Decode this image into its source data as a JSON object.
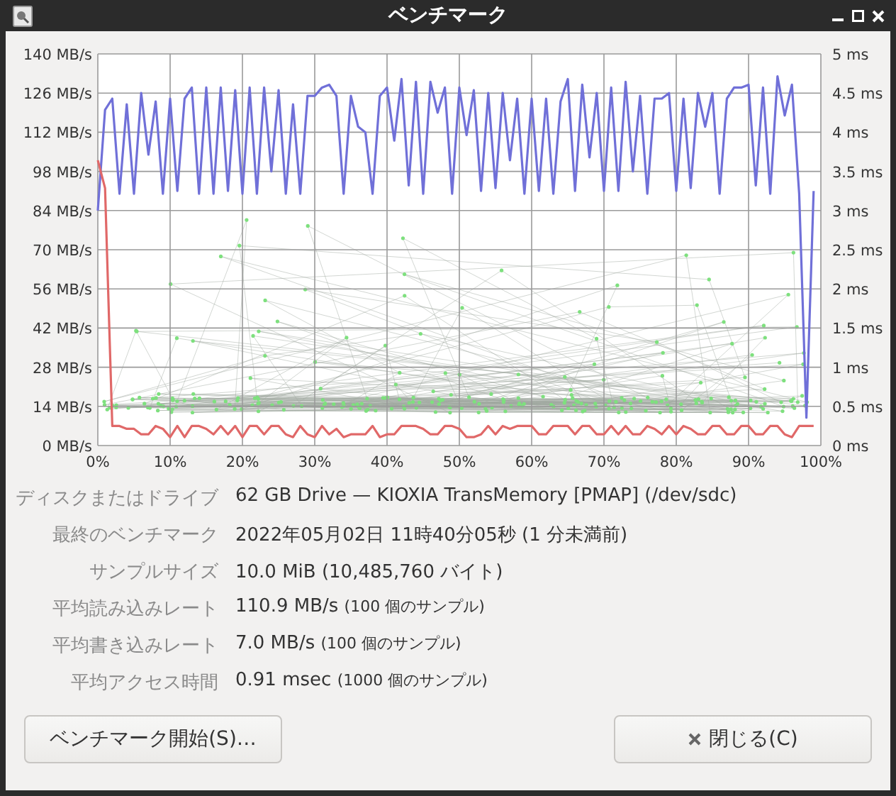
{
  "window": {
    "title": "ベンチマーク"
  },
  "chart": {
    "chart_data": {
      "type": "line",
      "grid": true,
      "xlim": [
        0,
        100
      ],
      "ylim": [
        0,
        140
      ],
      "y2lim": [
        0,
        5
      ],
      "x": [
        0,
        1,
        2,
        3,
        4,
        5,
        6,
        7,
        8,
        9,
        10,
        11,
        12,
        13,
        14,
        15,
        16,
        17,
        18,
        19,
        20,
        21,
        22,
        23,
        24,
        25,
        26,
        27,
        28,
        29,
        30,
        31,
        32,
        33,
        34,
        35,
        36,
        37,
        38,
        39,
        40,
        41,
        42,
        43,
        44,
        45,
        46,
        47,
        48,
        49,
        50,
        51,
        52,
        53,
        54,
        55,
        56,
        57,
        58,
        59,
        60,
        61,
        62,
        63,
        64,
        65,
        66,
        67,
        68,
        69,
        70,
        71,
        72,
        73,
        74,
        75,
        76,
        77,
        78,
        79,
        80,
        81,
        82,
        83,
        84,
        85,
        86,
        87,
        88,
        89,
        90,
        91,
        92,
        93,
        94,
        95,
        96,
        97,
        98,
        99
      ],
      "xticks": [
        {
          "value": 0,
          "label": "0%"
        },
        {
          "value": 10,
          "label": "10%"
        },
        {
          "value": 20,
          "label": "20%"
        },
        {
          "value": 30,
          "label": "30%"
        },
        {
          "value": 40,
          "label": "40%"
        },
        {
          "value": 50,
          "label": "50%"
        },
        {
          "value": 60,
          "label": "60%"
        },
        {
          "value": 70,
          "label": "70%"
        },
        {
          "value": 80,
          "label": "80%"
        },
        {
          "value": 90,
          "label": "90%"
        },
        {
          "value": 100,
          "label": "100%"
        }
      ],
      "yticks": [
        {
          "value": 0,
          "label": "0 MB/s"
        },
        {
          "value": 14,
          "label": "14 MB/s"
        },
        {
          "value": 28,
          "label": "28 MB/s"
        },
        {
          "value": 42,
          "label": "42 MB/s"
        },
        {
          "value": 56,
          "label": "56 MB/s"
        },
        {
          "value": 70,
          "label": "70 MB/s"
        },
        {
          "value": 84,
          "label": "84 MB/s"
        },
        {
          "value": 98,
          "label": "98 MB/s"
        },
        {
          "value": 112,
          "label": "112 MB/s"
        },
        {
          "value": 126,
          "label": "126 MB/s"
        },
        {
          "value": 140,
          "label": "140 MB/s"
        }
      ],
      "y2ticks": [
        {
          "value": 0,
          "label": "0 ms"
        },
        {
          "value": 0.5,
          "label": "0.5 ms"
        },
        {
          "value": 1,
          "label": "1 ms"
        },
        {
          "value": 1.5,
          "label": "1.5 ms"
        },
        {
          "value": 2,
          "label": "2 ms"
        },
        {
          "value": 2.5,
          "label": "2.5 ms"
        },
        {
          "value": 3,
          "label": "3 ms"
        },
        {
          "value": 3.5,
          "label": "3.5 ms"
        },
        {
          "value": 4,
          "label": "4 ms"
        },
        {
          "value": 4.5,
          "label": "4.5 ms"
        },
        {
          "value": 5,
          "label": "5 ms"
        }
      ],
      "series": [
        {
          "color": "#7070d8",
          "values": [
            84,
            120,
            124,
            90,
            122,
            90,
            126,
            104,
            123,
            90,
            124,
            91,
            124,
            128,
            90,
            128,
            90,
            128,
            91,
            127,
            90,
            128,
            90,
            128,
            98,
            127,
            90,
            122,
            90,
            125,
            125,
            128,
            129,
            125,
            90,
            125,
            114,
            112,
            90,
            125,
            128,
            109,
            131,
            93,
            130,
            90,
            130,
            119,
            128,
            90,
            128,
            111,
            127,
            91,
            126,
            92,
            126,
            102,
            124,
            90,
            124,
            91,
            124,
            90,
            123,
            131,
            91,
            129,
            103,
            126,
            91,
            128,
            91,
            130,
            98,
            125,
            90,
            124,
            124,
            126,
            91,
            124,
            92,
            126,
            114,
            126,
            90,
            124,
            128,
            128,
            129,
            93,
            128,
            90,
            132,
            118,
            129,
            90,
            10,
            91
          ]
        },
        {
          "color": "#e06868",
          "values": [
            102,
            92,
            7,
            7,
            6,
            6,
            4,
            4,
            7,
            6,
            3,
            7,
            3,
            7,
            7,
            6,
            4,
            7,
            4,
            7,
            3,
            7,
            7,
            4,
            7,
            7,
            4,
            3,
            7,
            4,
            3,
            7,
            4,
            6,
            3,
            4,
            4,
            4,
            7,
            3,
            4,
            4,
            7,
            7,
            7,
            6,
            4,
            4,
            7,
            7,
            6,
            3,
            3,
            4,
            7,
            4,
            7,
            6,
            7,
            7,
            7,
            4,
            4,
            7,
            7,
            7,
            4,
            7,
            7,
            4,
            4,
            7,
            4,
            7,
            4,
            4,
            7,
            6,
            4,
            7,
            4,
            7,
            6,
            4,
            4,
            7,
            7,
            4,
            4,
            7,
            7,
            4,
            4,
            7,
            7,
            4,
            3,
            7,
            7,
            7
          ]
        }
      ]
    }
  },
  "details": [
    {
      "label": "ディスクまたはドライブ",
      "value": "62 GB Drive — KIOXIA TransMemory [PMAP] (/dev/sdc)"
    },
    {
      "label": "最終のベンチマーク",
      "value": "2022年05月02日 11時40分05秒 (1 分未満前)"
    },
    {
      "label": "サンプルサイズ",
      "value": "10.0 MiB (10,485,760 バイト)"
    },
    {
      "label": "平均読み込みレート",
      "value": "110.9 MB/s",
      "note": "(100 個のサンプル)"
    },
    {
      "label": "平均書き込みレート",
      "value": "7.0 MB/s",
      "note": "(100 個のサンプル)"
    },
    {
      "label": "平均アクセス時間",
      "value": "0.91 msec",
      "note": "(1000 個のサンプル)"
    }
  ],
  "buttons": [
    {
      "label": "ベンチマーク開始(S)…",
      "kind": "start"
    },
    {
      "label": "閉じる(C)",
      "kind": "close"
    }
  ]
}
